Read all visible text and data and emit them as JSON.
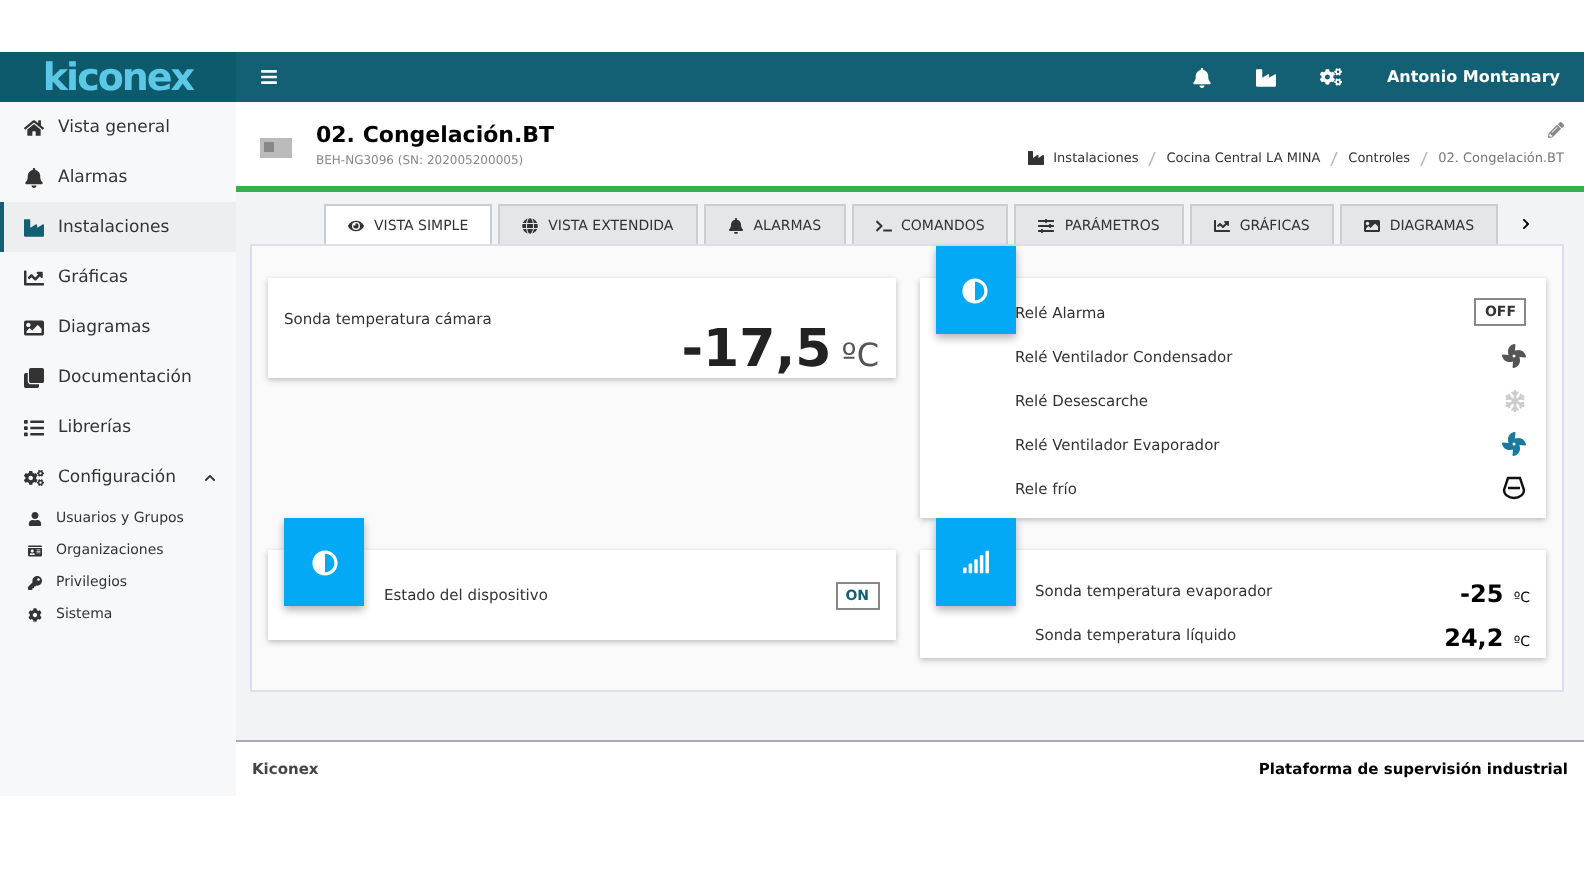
{
  "brand": "kiconex",
  "topbar": {
    "user": "Antonio Montanary"
  },
  "sidebar": {
    "items": [
      {
        "label": "Vista general",
        "selected": false
      },
      {
        "label": "Alarmas",
        "selected": false
      },
      {
        "label": "Instalaciones",
        "selected": true
      },
      {
        "label": "Gráficas",
        "selected": false
      },
      {
        "label": "Diagramas",
        "selected": false
      },
      {
        "label": "Documentación",
        "selected": false
      },
      {
        "label": "Librerías",
        "selected": false
      },
      {
        "label": "Configuración",
        "selected": false,
        "expanded": true,
        "children": [
          {
            "label": "Usuarios y Grupos"
          },
          {
            "label": "Organizaciones"
          },
          {
            "label": "Privilegios"
          },
          {
            "label": "Sistema"
          }
        ]
      }
    ]
  },
  "device": {
    "title": "02. Congelación.BT",
    "subtitle": "BEH-NG3096 (SN: 202005200005)"
  },
  "breadcrumb": [
    "Instalaciones",
    "Cocina Central LA MINA",
    "Controles",
    "02. Congelación.BT"
  ],
  "tabs": [
    {
      "label": "VISTA SIMPLE",
      "selected": true
    },
    {
      "label": "VISTA EXTENDIDA",
      "selected": false
    },
    {
      "label": "ALARMAS",
      "selected": false
    },
    {
      "label": "COMANDOS",
      "selected": false
    },
    {
      "label": "PARÁMETROS",
      "selected": false
    },
    {
      "label": "GRÁFICAS",
      "selected": false
    },
    {
      "label": "DIAGRAMAS",
      "selected": false
    }
  ],
  "main_probe": {
    "label": "Sonda temperatura cámara",
    "value": "-17,5",
    "unit": "ºC"
  },
  "relays": [
    {
      "label": "Relé Alarma",
      "kind": "badge",
      "value": "OFF"
    },
    {
      "label": "Relé Ventilador Condensador",
      "kind": "fan",
      "on": false
    },
    {
      "label": "Relé Desescarche",
      "kind": "defrost",
      "on": false
    },
    {
      "label": "Relé Ventilador Evaporador",
      "kind": "fan",
      "on": true
    },
    {
      "label": "Rele frío",
      "kind": "compressor"
    }
  ],
  "device_state": {
    "label": "Estado del dispositivo",
    "value": "ON"
  },
  "probes": [
    {
      "label": "Sonda temperatura evaporador",
      "value": "-25",
      "unit": "ºC"
    },
    {
      "label": "Sonda temperatura líquido",
      "value": "24,2",
      "unit": "ºC"
    }
  ],
  "footer": {
    "left": "Kiconex",
    "right": "Plataforma de supervisión industrial"
  }
}
